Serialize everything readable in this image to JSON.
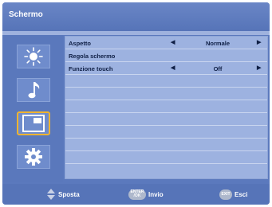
{
  "header": {
    "title": "Schermo"
  },
  "sidebar": {
    "items": [
      {
        "icon": "brightness-icon"
      },
      {
        "icon": "music-note-icon"
      },
      {
        "icon": "screen-icon",
        "selected": true
      },
      {
        "icon": "gear-icon"
      }
    ]
  },
  "menu": {
    "rows": [
      {
        "label": "Aspetto",
        "value": "Normale",
        "arrows": true
      },
      {
        "label": "Regola schermo",
        "value": "",
        "arrows": false
      },
      {
        "label": "Funzione touch",
        "value": "Off",
        "arrows": true
      },
      {
        "label": "",
        "value": "",
        "arrows": false
      },
      {
        "label": "",
        "value": "",
        "arrows": false
      },
      {
        "label": "",
        "value": "",
        "arrows": false
      },
      {
        "label": "",
        "value": "",
        "arrows": false
      },
      {
        "label": "",
        "value": "",
        "arrows": false
      },
      {
        "label": "",
        "value": "",
        "arrows": false
      },
      {
        "label": "",
        "value": "",
        "arrows": false
      },
      {
        "label": "",
        "value": "",
        "arrows": false
      }
    ]
  },
  "footer": {
    "move_label": "Sposta",
    "enter_key_top": "ENTER",
    "enter_key_bottom": "/OK",
    "enter_label": "Invio",
    "exit_key": "EXIT",
    "exit_label": "Esci"
  },
  "colors": {
    "background": "#5b79bd",
    "menu_panel": "#9db2e0",
    "selection": "#f0b430",
    "text_dark": "#0f1f45"
  }
}
